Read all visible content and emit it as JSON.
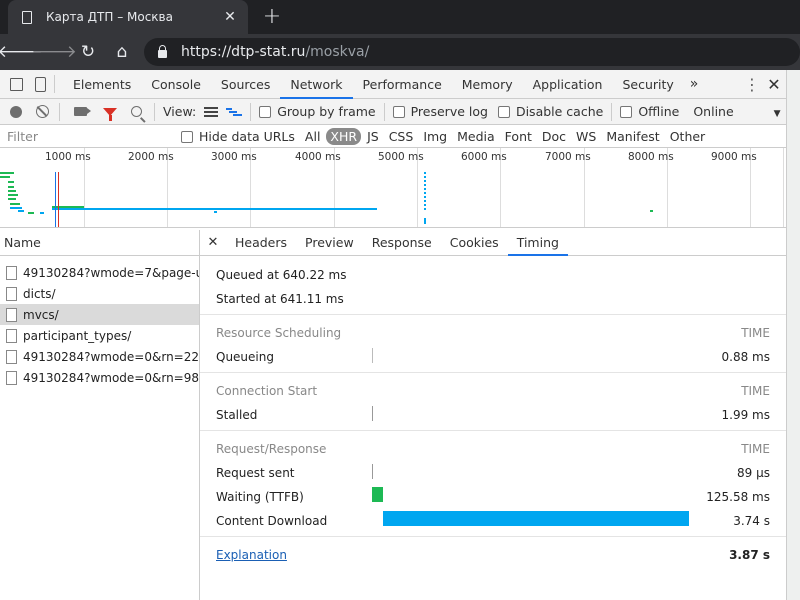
{
  "browser": {
    "tab_title": "Карта ДТП – Москва",
    "url_host": "https://dtp-stat.ru",
    "url_path": "/moskva/"
  },
  "devtools": {
    "panels": [
      "Elements",
      "Console",
      "Sources",
      "Network",
      "Performance",
      "Memory",
      "Application",
      "Security"
    ],
    "active_panel": "Network",
    "more_label": "»",
    "toolbar": {
      "view_label": "View:",
      "group_by_frame": "Group by frame",
      "preserve_log": "Preserve log",
      "disable_cache": "Disable cache",
      "offline": "Offline",
      "throttle": "Online",
      "throttle_arrow": "▼"
    },
    "filter": {
      "placeholder": "Filter",
      "hide_data_urls": "Hide data URLs",
      "types": [
        "All",
        "XHR",
        "JS",
        "CSS",
        "Img",
        "Media",
        "Font",
        "Doc",
        "WS",
        "Manifest",
        "Other"
      ],
      "active_type": "XHR"
    },
    "overview_ticks": [
      "1000 ms",
      "2000 ms",
      "3000 ms",
      "4000 ms",
      "5000 ms",
      "6000 ms",
      "7000 ms",
      "8000 ms",
      "9000 ms"
    ],
    "name_header": "Name",
    "requests": [
      "49130284?wmode=7&page-ur...",
      "dicts/",
      "mvcs/",
      "participant_types/",
      "49130284?wmode=0&rn=222...",
      "49130284?wmode=0&rn=982..."
    ],
    "selected_request_index": 2,
    "detail_tabs": [
      "Headers",
      "Preview",
      "Response",
      "Cookies",
      "Timing"
    ],
    "active_detail_tab": "Timing",
    "timing": {
      "queued_at": "Queued at 640.22 ms",
      "started_at": "Started at 641.11 ms",
      "time_header": "TIME",
      "sections": [
        {
          "title": "Resource Scheduling",
          "rows": [
            {
              "label": "Queueing",
              "value": "0.88 ms"
            }
          ]
        },
        {
          "title": "Connection Start",
          "rows": [
            {
              "label": "Stalled",
              "value": "1.99 ms"
            }
          ]
        },
        {
          "title": "Request/Response",
          "rows": [
            {
              "label": "Request sent",
              "value": "89 µs"
            },
            {
              "label": "Waiting (TTFB)",
              "value": "125.58 ms"
            },
            {
              "label": "Content Download",
              "value": "3.74 s"
            }
          ]
        }
      ],
      "explanation": "Explanation",
      "total": "3.87 s"
    },
    "colors": {
      "ttfb": "#1db954",
      "download": "#00a6f0",
      "active_tab": "#1a73e8"
    }
  }
}
